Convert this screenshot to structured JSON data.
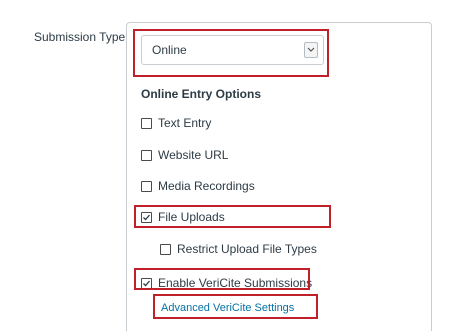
{
  "field": {
    "label": "Submission Type"
  },
  "select": {
    "value": "Online",
    "arrow_icon": "chevron-down-icon"
  },
  "online_entry": {
    "title": "Online Entry Options",
    "options": [
      {
        "label": "Text Entry",
        "checked": false
      },
      {
        "label": "Website URL",
        "checked": false
      },
      {
        "label": "Media Recordings",
        "checked": false
      },
      {
        "label": "File Uploads",
        "checked": true
      },
      {
        "label": "Restrict Upload File Types",
        "checked": false
      },
      {
        "label": "Enable VeriCite Submissions",
        "checked": true
      }
    ],
    "advanced_link": "Advanced VeriCite Settings"
  },
  "highlight_color": "#c0202a",
  "link_color": "#0770a3"
}
